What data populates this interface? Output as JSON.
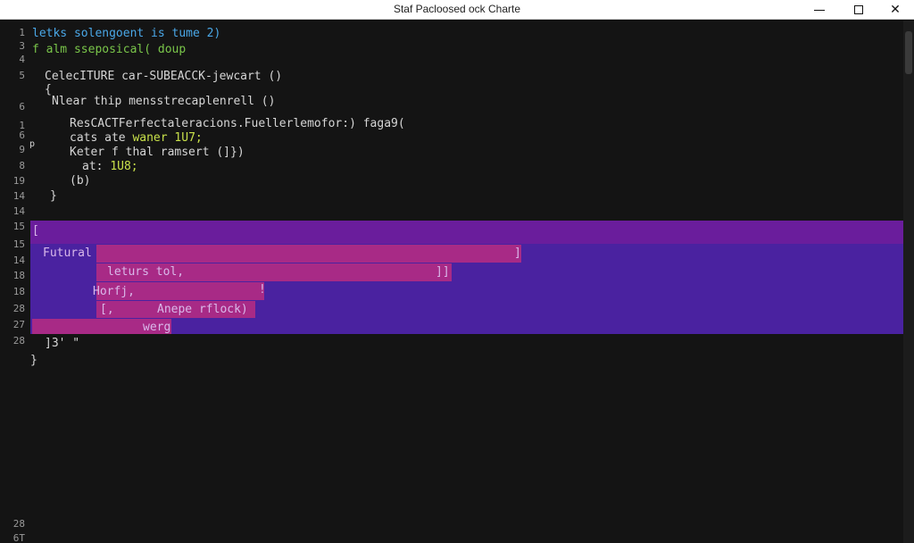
{
  "window": {
    "title": "Staf Pacloosed ock Charte"
  },
  "gutter": {
    "line_numbers": [
      "1",
      "3",
      "4",
      "5",
      "6",
      "1",
      "6",
      "9",
      "8",
      "19",
      "14",
      "14",
      "15",
      "15",
      "14",
      "18",
      "18",
      "28",
      "27",
      "28",
      "28",
      "6T"
    ]
  },
  "code": {
    "lines": [
      {
        "text": "letks solengoent is tume 2)",
        "color": "blue"
      },
      {
        "text": "f alm sseposical( doup",
        "color": "green"
      },
      {
        "text": "CelecITURE car-SUBEACCK-jewcart ()",
        "color": "plain"
      },
      {
        "text": "{",
        "color": "plain"
      },
      {
        "text": "Nlear thip mensstrecaplenrell ()",
        "color": "plain"
      },
      {
        "text": "ResCACTFerfectaleracions.Fuellerlemofor:) faga9(",
        "color": "plain"
      },
      {
        "text": "cats ate ",
        "color": "plain",
        "tail": "waner 1U7;"
      },
      {
        "text": "Keter f thal ramsert (]})",
        "color": "plain"
      },
      {
        "text": "at: ",
        "color": "plain",
        "tail": "1U8;"
      },
      {
        "text": "(b)",
        "color": "plain"
      },
      {
        "text": "}",
        "color": "plain"
      },
      {
        "text": "p",
        "color": "plain"
      }
    ],
    "selection_lines": [
      {
        "text": "["
      },
      {
        "text": "Futural"
      },
      {
        "text": "]"
      },
      {
        "text": "leturs tol,"
      },
      {
        "text": "]]"
      },
      {
        "text": "Horfj,"
      },
      {
        "text": "!"
      },
      {
        "text": "[,"
      },
      {
        "text": "Anepe rflock)"
      },
      {
        "text": "werg"
      }
    ],
    "after_lines": [
      {
        "text": "]3' \""
      },
      {
        "text": "}"
      }
    ]
  }
}
